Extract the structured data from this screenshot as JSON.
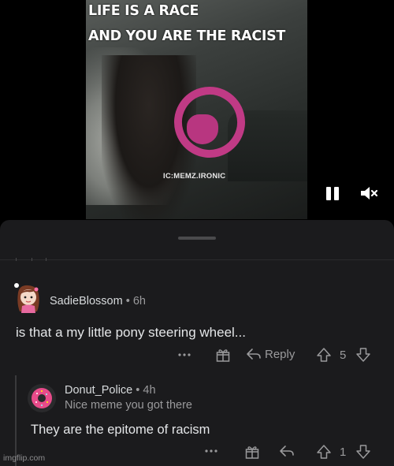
{
  "video": {
    "meme_line1": "LIFE IS A RACE",
    "meme_line2": "AND YOU ARE THE RACIST",
    "watermark": "IC:MEMZ.IRONIC",
    "controls": {
      "pause_icon": "pause-icon",
      "mute_icon": "speaker-muted-icon"
    }
  },
  "comments": [
    {
      "author": "SadieBlossom",
      "separator": "•",
      "age": "6h",
      "text": "is that a my little pony steering wheel...",
      "actions": {
        "more_icon": "more-icon",
        "award_icon": "award-icon",
        "reply_label": "Reply",
        "upvote_count": "5"
      }
    },
    {
      "author": "Donut_Police",
      "separator": "•",
      "age": "4h",
      "flair": "Nice meme you got there",
      "text": "They are the epitome of racism",
      "actions": {
        "more_icon": "more-icon",
        "award_icon": "award-icon",
        "upvote_count": "1"
      }
    }
  ],
  "watermark_site": "imgflip.com"
}
